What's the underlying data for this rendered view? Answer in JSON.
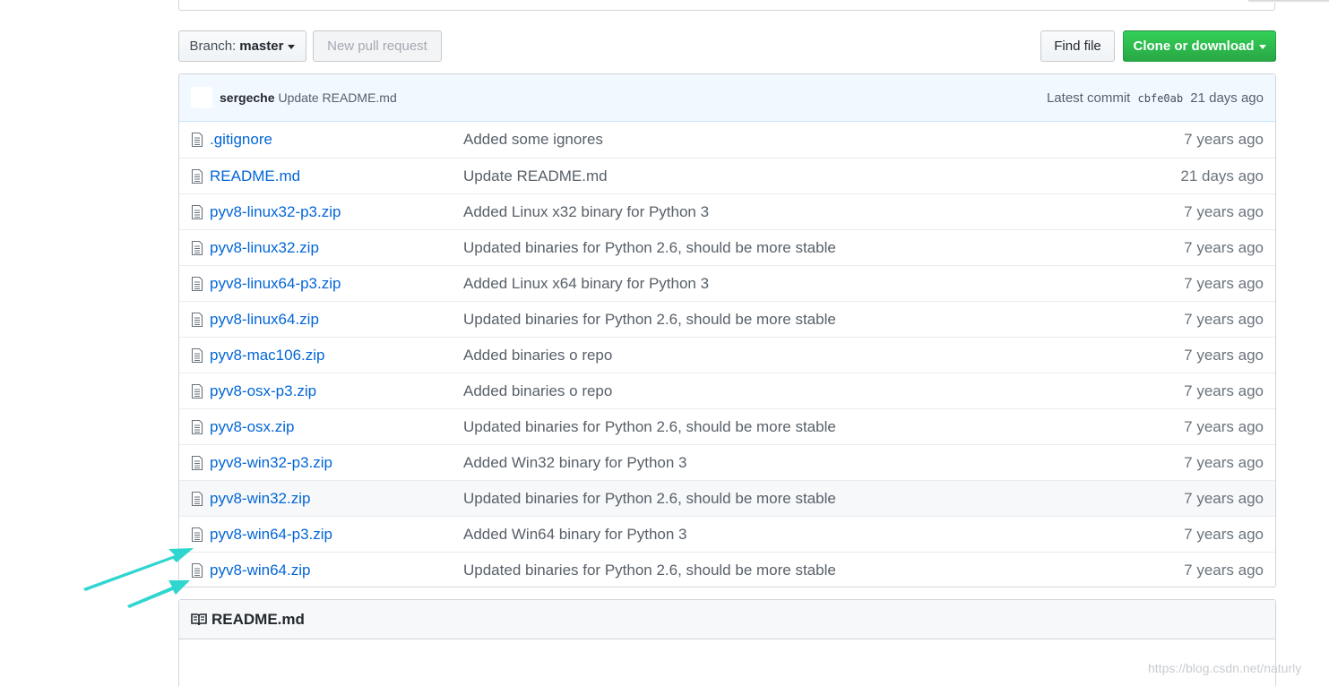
{
  "toolbar": {
    "branch_label": "Branch:",
    "branch_value": "master",
    "new_pull_request": "New pull request",
    "find_file": "Find file",
    "clone_or_download": "Clone or download"
  },
  "latest_commit": {
    "author": "sergeche",
    "message": "Update README.md",
    "label": "Latest commit",
    "sha": "cbfe0ab",
    "age": "21 days ago"
  },
  "files": [
    {
      "name": ".gitignore",
      "message": "Added some ignores",
      "age": "7 years ago"
    },
    {
      "name": "README.md",
      "message": "Update README.md",
      "age": "21 days ago"
    },
    {
      "name": "pyv8-linux32-p3.zip",
      "message": "Added Linux x32 binary for Python 3",
      "age": "7 years ago"
    },
    {
      "name": "pyv8-linux32.zip",
      "message": "Updated binaries for Python 2.6, should be more stable",
      "age": "7 years ago"
    },
    {
      "name": "pyv8-linux64-p3.zip",
      "message": "Added Linux x64 binary for Python 3",
      "age": "7 years ago"
    },
    {
      "name": "pyv8-linux64.zip",
      "message": "Updated binaries for Python 2.6, should be more stable",
      "age": "7 years ago"
    },
    {
      "name": "pyv8-mac106.zip",
      "message": "Added binaries o repo",
      "age": "7 years ago"
    },
    {
      "name": "pyv8-osx-p3.zip",
      "message": "Added binaries o repo",
      "age": "7 years ago"
    },
    {
      "name": "pyv8-osx.zip",
      "message": "Updated binaries for Python 2.6, should be more stable",
      "age": "7 years ago"
    },
    {
      "name": "pyv8-win32-p3.zip",
      "message": "Added Win32 binary for Python 3",
      "age": "7 years ago"
    },
    {
      "name": "pyv8-win32.zip",
      "message": "Updated binaries for Python 2.6, should be more stable",
      "age": "7 years ago"
    },
    {
      "name": "pyv8-win64-p3.zip",
      "message": "Added Win64 binary for Python 3",
      "age": "7 years ago"
    },
    {
      "name": "pyv8-win64.zip",
      "message": "Updated binaries for Python 2.6, should be more stable",
      "age": "7 years ago"
    }
  ],
  "readme": {
    "title": "README.md"
  },
  "watermark": "https://blog.csdn.net/naturly",
  "colors": {
    "link": "#0366d6",
    "clone_button": "#28a745",
    "commit_bar": "#f1f8ff",
    "annotation_arrow": "#2fd6cf"
  },
  "icons": {
    "file": "file-icon",
    "readme": "book-icon",
    "caret": "caret-down-icon"
  }
}
